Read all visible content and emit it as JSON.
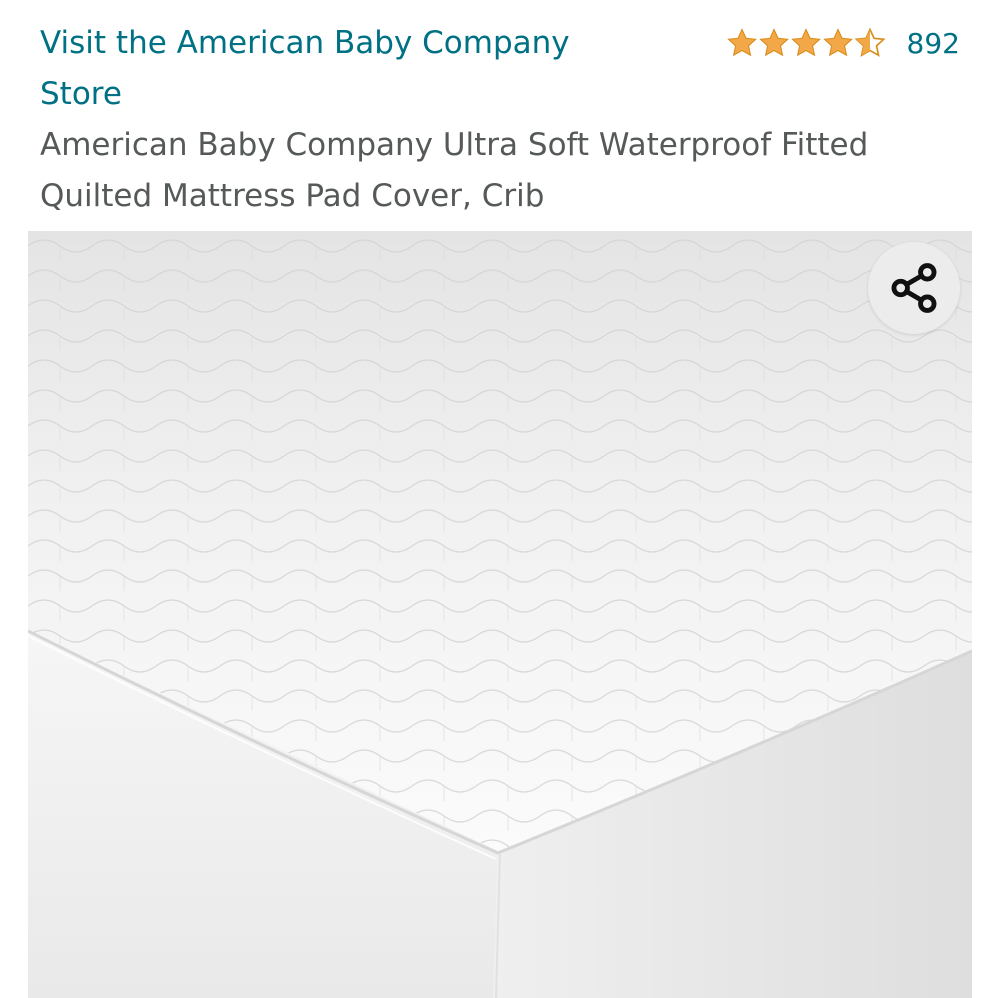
{
  "header": {
    "store_link": "Visit the American Baby Company Store",
    "rating": {
      "stars": 4.5,
      "count": "892",
      "star_color": "#F3A847"
    }
  },
  "product": {
    "title": "American Baby Company Ultra Soft Waterproof Fitted Quilted Mattress Pad Cover, Crib"
  },
  "image_overlay": {
    "share_icon": "share-icon"
  },
  "colors": {
    "link": "#007185",
    "title": "#565959",
    "share_bg": "#ECECEC"
  }
}
